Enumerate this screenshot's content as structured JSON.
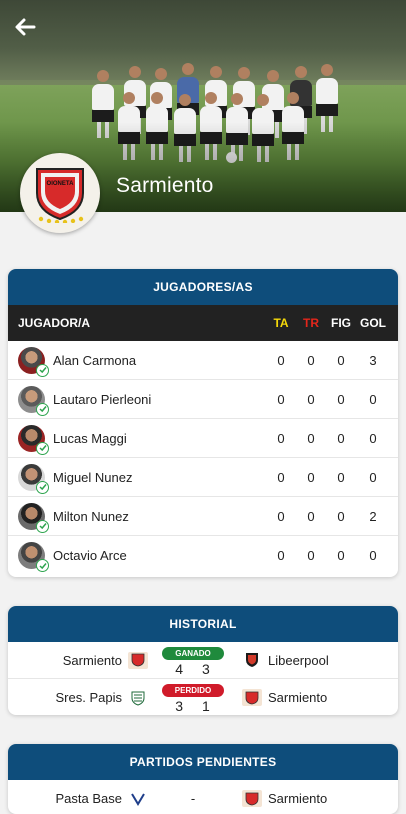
{
  "team": {
    "name": "Sarmiento",
    "crest_text": "OIONETA"
  },
  "nav": {
    "back_icon": "arrow-left-icon"
  },
  "players_card": {
    "title": "JUGADORES/AS",
    "headers": {
      "player": "JUGADOR/A",
      "ta": "TA",
      "tr": "TR",
      "fig": "FIG",
      "gol": "GOL"
    },
    "colors": {
      "ta": "#f5d90a",
      "tr": "#e4261b",
      "header": "#0e4d7b"
    },
    "rows": [
      {
        "name": "Alan Carmona",
        "ta": "0",
        "tr": "0",
        "fig": "0",
        "gol": "3"
      },
      {
        "name": "Lautaro Pierleoni",
        "ta": "0",
        "tr": "0",
        "fig": "0",
        "gol": "0"
      },
      {
        "name": "Lucas Maggi",
        "ta": "0",
        "tr": "0",
        "fig": "0",
        "gol": "0"
      },
      {
        "name": "Miguel Nunez",
        "ta": "0",
        "tr": "0",
        "fig": "0",
        "gol": "0"
      },
      {
        "name": "Milton Nunez",
        "ta": "0",
        "tr": "0",
        "fig": "0",
        "gol": "2"
      },
      {
        "name": "Octavio Arce",
        "ta": "0",
        "tr": "0",
        "fig": "0",
        "gol": "0"
      }
    ]
  },
  "history_card": {
    "title": "HISTORIAL",
    "matches": [
      {
        "home": "Sarmiento",
        "away": "Libeerpool",
        "result": "GANADO",
        "home_score": "4",
        "away_score": "3",
        "result_color": "#1f8a3c"
      },
      {
        "home": "Sres. Papis",
        "away": "Sarmiento",
        "result": "PERDIDO",
        "home_score": "3",
        "away_score": "1",
        "result_color": "#d01b2a"
      }
    ]
  },
  "pending_card": {
    "title": "PARTIDOS PENDIENTES",
    "matches": [
      {
        "home": "Pasta Base",
        "away": "Sarmiento",
        "separator": "-"
      }
    ]
  }
}
